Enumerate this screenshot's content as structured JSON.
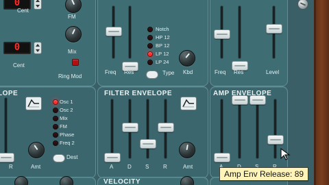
{
  "osc": {
    "top": {
      "cent_label": "Cent",
      "digit_display": "0",
      "fm_label": "FM"
    },
    "mid": {
      "digit_display": "0",
      "mix_label": "Mix",
      "cent_label": "Cent",
      "ring_mod_label": "Ring Mod"
    },
    "envelope_partial_title": "LOPE",
    "envelope_dest_options": [
      "Osc 1",
      "Osc 2",
      "Mix",
      "FM",
      "Phase",
      "Freq 2"
    ],
    "envelope_dest_selected_index": 0,
    "dest_button_label": "Dest",
    "amt_label": "Amt",
    "r_label": "R"
  },
  "filter": {
    "type_list": [
      "Notch",
      "HP 12",
      "BP 12",
      "LP 12",
      "LP 24"
    ],
    "type_selected_index": 3,
    "freq_label": "Freq",
    "res_label": "Res",
    "type_label": "Type",
    "kbd_label": "Kbd",
    "filter2": {
      "freq_label": "Freq",
      "res_label": "Res",
      "level_label": "Level"
    }
  },
  "filter_envelope": {
    "title": "FILTER ENVELOPE",
    "labels": [
      "A",
      "D",
      "S",
      "R"
    ],
    "amt_label": "Amt"
  },
  "amp_envelope": {
    "title": "AMP ENVELOPE",
    "labels": [
      "A",
      "D",
      "S",
      "R"
    ]
  },
  "velocity": {
    "title": "VELOCITY"
  },
  "tooltip": {
    "text": "Amp Env Release: 89"
  },
  "colors": {
    "panel": "#3f6d74",
    "panel_border": "#5f8f96",
    "led_on": "#ff2f2f",
    "segment_text": "#ff2a2a",
    "tooltip_bg": "#fff4b8",
    "wood": "#6f391c"
  },
  "icons": {
    "spinner": "spinner-icon",
    "envelope_shape": "envelope-shape-icon",
    "cursor": "mouse-pointer-icon",
    "screw": "screw-icon"
  }
}
